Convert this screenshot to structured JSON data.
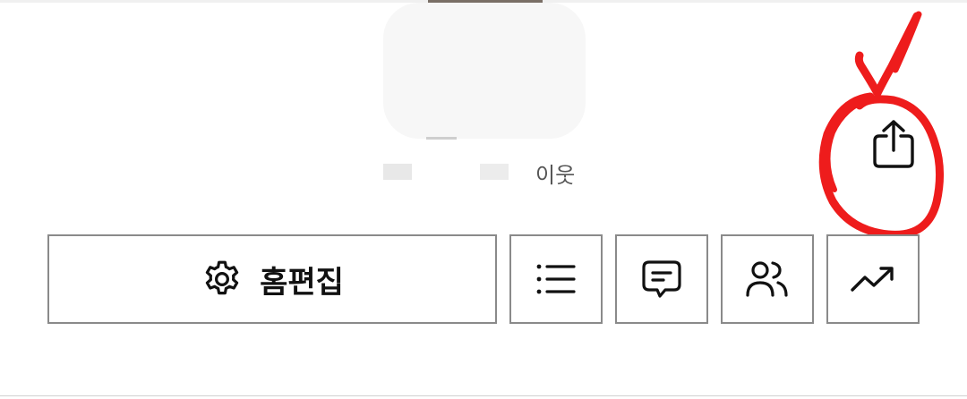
{
  "profile": {
    "neighbor_suffix": "이웃"
  },
  "actions": {
    "home_edit_label": "홈편집"
  },
  "icons": {
    "share": "share-icon",
    "settings": "gear-icon",
    "list": "list-icon",
    "chat": "message-icon",
    "friends": "people-icon",
    "stats": "trending-up-icon"
  },
  "annotation": {
    "color": "#ee1c1c"
  }
}
